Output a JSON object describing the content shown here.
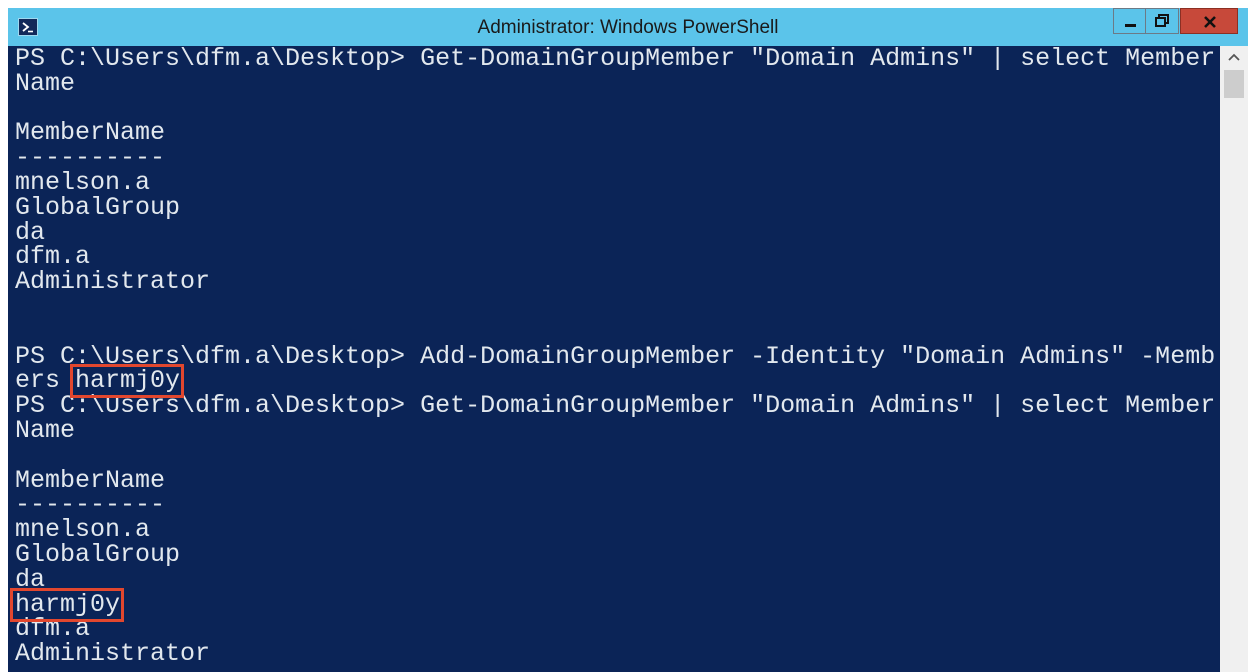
{
  "window": {
    "title": "Administrator: Windows PowerShell"
  },
  "colors": {
    "console_bg": "#0b2457",
    "console_text": "#e2e8ee",
    "titlebar": "#5bc4ea",
    "close_button": "#c7493a",
    "highlight_box": "#e2472e"
  },
  "console": {
    "lines": [
      "PS C:\\Users\\dfm.a\\Desktop> Get-DomainGroupMember \"Domain Admins\" | select Member",
      "Name",
      "",
      "MemberName",
      "----------",
      "mnelson.a",
      "GlobalGroup",
      "da",
      "dfm.a",
      "Administrator",
      "",
      "",
      "PS C:\\Users\\dfm.a\\Desktop> Add-DomainGroupMember -Identity \"Domain Admins\" -Memb",
      "ers ",
      "PS C:\\Users\\dfm.a\\Desktop> Get-DomainGroupMember \"Domain Admins\" | select Member",
      "Name",
      "",
      "MemberName",
      "----------",
      "mnelson.a",
      "GlobalGroup",
      "da",
      "",
      "dfm.a",
      "Administrator"
    ],
    "highlight_arg": "harmj0y",
    "highlight_member": "harmj0y"
  }
}
